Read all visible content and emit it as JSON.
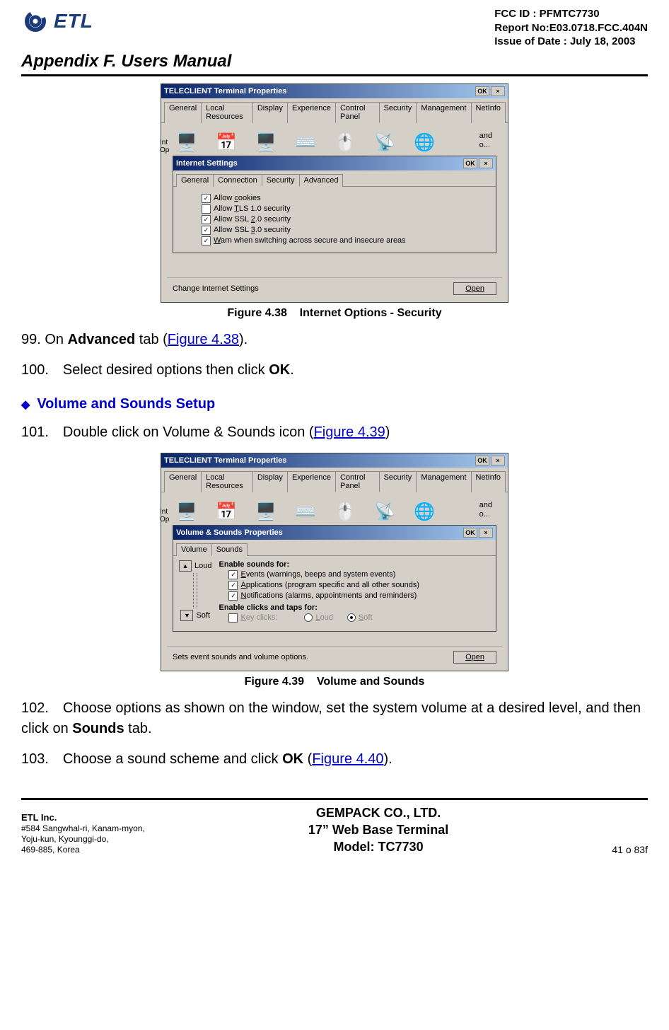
{
  "header": {
    "logo_text": "ETL",
    "fcc_id": "FCC ID : PFMTC7730",
    "report_no": "Report No:E03.0718.FCC.404N",
    "issue_date": "Issue of Date : July 18, 2003",
    "appendix_title": "Appendix F.  Users Manual"
  },
  "fig438": {
    "outer_title": "TELECLIENT Terminal Properties",
    "outer_tabs": [
      "General",
      "Local Resources",
      "Display",
      "Experience",
      "Control Panel",
      "Security",
      "Management",
      "NetInfo"
    ],
    "side_text_1": "and",
    "side_text_2": "o...",
    "stub_1": "Int",
    "stub_2": "Op",
    "inner_title": "Internet Settings",
    "inner_tabs": [
      "General",
      "Connection",
      "Security",
      "Advanced"
    ],
    "checks": {
      "c0": {
        "checked": true,
        "label_pre": "Allow ",
        "u": "c",
        "label_post": "ookies"
      },
      "c1": {
        "checked": false,
        "label_pre": "Allow ",
        "u": "T",
        "label_post": "LS 1.0 security"
      },
      "c2": {
        "checked": true,
        "label_pre": "Allow SSL ",
        "u": "2",
        "label_post": ".0 security"
      },
      "c3": {
        "checked": true,
        "label_pre": "Allow SSL ",
        "u": "3",
        "label_post": ".0 security"
      },
      "c4": {
        "checked": true,
        "label_pre": "",
        "u": "W",
        "label_post": "arn when switching across secure and insecure areas"
      }
    },
    "status_text": "Change Internet Settings",
    "open_label": "Open",
    "ok_label": "OK",
    "close_label": "×",
    "caption_num": "Figure 4.38",
    "caption_text": "Internet Options - Security"
  },
  "body": {
    "step99_pre": "99. On ",
    "step99_bold": "Advanced",
    "step99_mid": " tab (",
    "step99_link": "Figure 4.38",
    "step99_post": ").",
    "step100_pre": "100. Select desired options then click ",
    "step100_bold": "OK",
    "step100_post": ".",
    "section_heading": "Volume and Sounds Setup",
    "step101_pre": "101. Double click on Volume & Sounds icon (",
    "step101_link": "Figure 4.39",
    "step101_post": ")",
    "step102_pre": "102. Choose options as shown on the window, set the system volume at a desired level, and then click on ",
    "step102_bold": "Sounds",
    "step102_post": " tab.",
    "step103_pre": "103. Choose a sound scheme and click ",
    "step103_bold": "OK",
    "step103_mid": " (",
    "step103_link": "Figure 4.40",
    "step103_post": ")."
  },
  "fig439": {
    "outer_title": "TELECLIENT Terminal Properties",
    "outer_tabs": [
      "General",
      "Local Resources",
      "Display",
      "Experience",
      "Control Panel",
      "Security",
      "Management",
      "NetInfo"
    ],
    "side_text_1": "and",
    "side_text_2": "o...",
    "stub_1": "Int",
    "stub_2": "Op",
    "inner_title": "Volume & Sounds Properties",
    "inner_tabs": [
      "Volume",
      "Sounds"
    ],
    "loud_label": "Loud",
    "soft_label": "Soft",
    "heading1": "Enable sounds for:",
    "chk1": {
      "u": "E",
      "rest": "vents (warnings, beeps and system events)"
    },
    "chk2": {
      "u": "A",
      "rest": "pplications (program specific and all other sounds)"
    },
    "chk3": {
      "u": "N",
      "rest": "otifications (alarms, appointments and reminders)"
    },
    "heading2": "Enable clicks and taps for:",
    "chk4": {
      "u": "K",
      "rest": "ey clicks:"
    },
    "radio_loud": {
      "u": "L",
      "rest": "oud"
    },
    "radio_soft": {
      "u": "S",
      "rest": "oft"
    },
    "status_text": "Sets event sounds and volume options.",
    "open_label": "Open",
    "ok_label": "OK",
    "close_label": "×",
    "caption_num": "Figure 4.39",
    "caption_text": "Volume and Sounds"
  },
  "footer": {
    "company": "ETL Inc.",
    "addr1": "#584 Sangwhal-ri, Kanam-myon,",
    "addr2": "Yoju-kun, Kyounggi-do,",
    "addr3": "469-885, Korea",
    "center1": "GEMPACK CO., LTD.",
    "center2": "17” Web Base Terminal",
    "center3": "Model: TC7730",
    "page": "41 o 83f"
  }
}
